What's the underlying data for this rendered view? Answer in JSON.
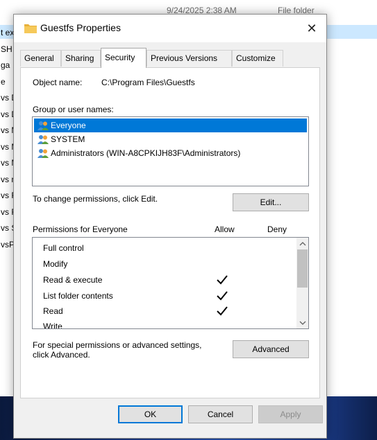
{
  "background": {
    "header_date": "9/24/2025 2:38 AM",
    "header_type": "File folder",
    "left_fragments": [
      "t ex",
      "SH",
      "ga",
      "e",
      "vs D",
      "vs D",
      "vs M",
      "vs M",
      "vs M",
      "vs n",
      "vs F",
      "vs F",
      "vs S",
      "vsP"
    ]
  },
  "dialog": {
    "title": "Guestfs Properties",
    "close_glyph": "✕",
    "tabs": [
      "General",
      "Sharing",
      "Security",
      "Previous Versions",
      "Customize"
    ],
    "active_tab": "Security",
    "object_label": "Object name:",
    "object_value": "C:\\Program Files\\Guestfs",
    "group_label": "Group or user names:",
    "users": [
      {
        "name": "Everyone",
        "selected": true
      },
      {
        "name": "SYSTEM",
        "selected": false
      },
      {
        "name": "Administrators (WIN-A8CPKIJH83F\\Administrators)",
        "selected": false
      }
    ],
    "change_text": "To change permissions, click Edit.",
    "edit_button": "Edit...",
    "permissions_label": "Permissions for Everyone",
    "allow_header": "Allow",
    "deny_header": "Deny",
    "permissions": [
      {
        "name": "Full control",
        "allow": false,
        "deny": false
      },
      {
        "name": "Modify",
        "allow": false,
        "deny": false
      },
      {
        "name": "Read & execute",
        "allow": true,
        "deny": false
      },
      {
        "name": "List folder contents",
        "allow": true,
        "deny": false
      },
      {
        "name": "Read",
        "allow": true,
        "deny": false
      },
      {
        "name": "Write",
        "allow": false,
        "deny": false
      }
    ],
    "special_text_line1": "For special permissions or advanced settings,",
    "special_text_line2": "click Advanced.",
    "advanced_button": "Advanced",
    "ok_button": "OK",
    "cancel_button": "Cancel",
    "apply_button": "Apply",
    "apply_enabled": false
  },
  "icons": {
    "title": "folder-icon",
    "user": "users-group-icon",
    "check": "checkmark-icon",
    "scroll_up": "chevron-up-icon",
    "scroll_down": "chevron-down-icon"
  },
  "colors": {
    "selection": "#0078d7",
    "folder": "#e8b13b",
    "taskbar": "#1f3f8f"
  }
}
